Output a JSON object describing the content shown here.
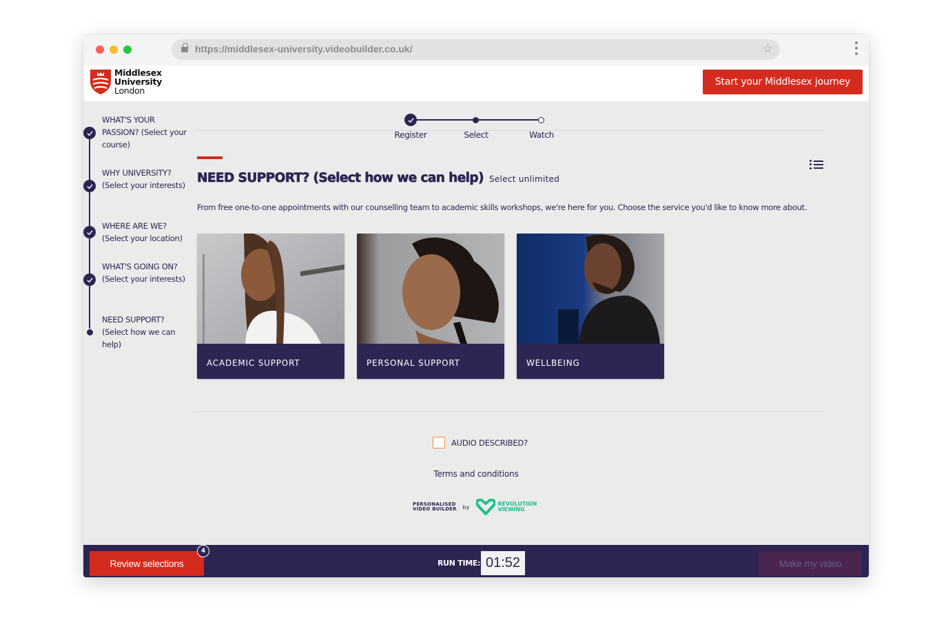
{
  "browser": {
    "url": "https://middlesex-university.videobuilder.co.uk/"
  },
  "header": {
    "logo_lines": [
      "Middlesex",
      "University",
      "London"
    ],
    "cta_label": "Start your Middlesex journey",
    "brand_red": "#d52b1e",
    "brand_navy": "#2b2552"
  },
  "sidebar": {
    "steps": [
      {
        "label": "WHAT'S YOUR PASSION? (Select your course)",
        "state": "complete"
      },
      {
        "label": "WHY UNIVERSITY? (Select your interests)",
        "state": "complete"
      },
      {
        "label": "WHERE ARE WE? (Select your location)",
        "state": "complete"
      },
      {
        "label": "WHAT'S GOING ON? (Select your interests)",
        "state": "complete"
      },
      {
        "label": "NEED SUPPORT? (Select how we can help)",
        "state": "current"
      }
    ]
  },
  "progress": {
    "steps": [
      {
        "label": "Register",
        "state": "complete"
      },
      {
        "label": "Select",
        "state": "current"
      },
      {
        "label": "Watch",
        "state": "upcoming"
      }
    ]
  },
  "section": {
    "title": "NEED SUPPORT? (Select how we can help)",
    "hint": "Select unlimited",
    "intro": "From free one-to-one appointments with our counselling team to academic skills workshops, we're here for you. Choose the service you'd like to know more about.",
    "cards": [
      {
        "label": "ACADEMIC SUPPORT"
      },
      {
        "label": "PERSONAL SUPPORT"
      },
      {
        "label": "WELLBEING"
      }
    ]
  },
  "footer": {
    "audio_label": "AUDIO DESCRIBED?",
    "audio_checked": false,
    "terms_label": "Terms and conditions",
    "pvb_lines": [
      "PERSONALISED",
      "VIDEO BUILDER"
    ],
    "by": "by",
    "rv_lines": [
      "REVOLUTION",
      "VIEWING"
    ]
  },
  "bottom_bar": {
    "review_label": "Review selections",
    "selection_count": "4",
    "runtime_label": "RUN TIME:",
    "runtime_value": "01:52",
    "make_label": "Make my video",
    "make_enabled": false
  }
}
